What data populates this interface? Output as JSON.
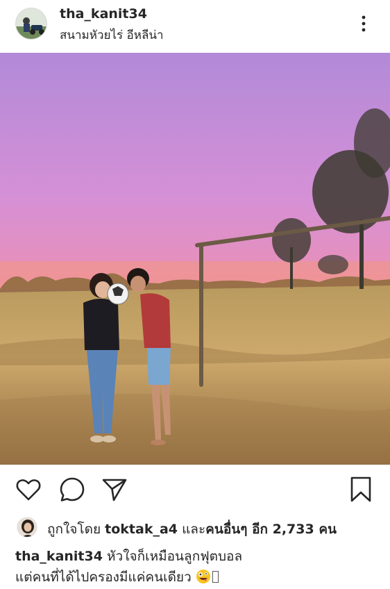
{
  "post": {
    "username": "tha_kanit34",
    "location": "สนามหัวยไร่ อีหลีน่า"
  },
  "likes": {
    "prefix": "ถูกใจโดย",
    "liker": "toktak_a4",
    "joiner": "และ",
    "others": "คนอื่นๆ อีก 2,733 คน"
  },
  "caption": {
    "username": "tha_kanit34",
    "line1": "หัวใจก็เหมือนลูกฟุตบอล",
    "line2": "แต่คนที่ได้ไปครองมีแค่คนเดียว"
  },
  "icons": {
    "more": "more-vertical-icon",
    "like": "heart-icon",
    "comment": "comment-icon",
    "share": "paper-plane-icon",
    "save": "bookmark-icon",
    "emoji": "zany-face-emoji"
  },
  "colors": {
    "text": "#262626",
    "sky_top": "#b48bd6",
    "sky_bottom": "#f58a8a",
    "field": "#c9a366"
  }
}
